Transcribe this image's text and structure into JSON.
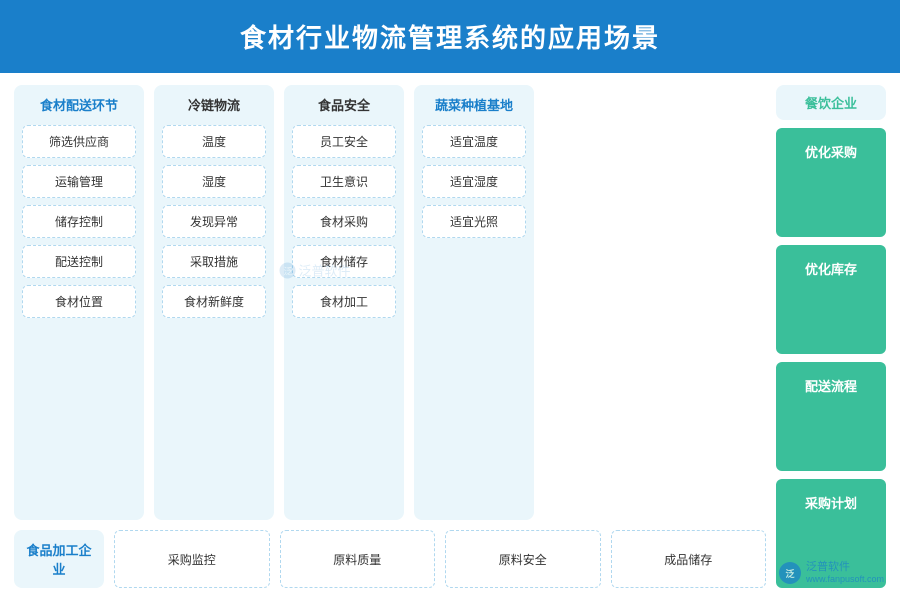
{
  "header": {
    "title": "食材行业物流管理系统的应用场景"
  },
  "columns": [
    {
      "id": "food-delivery",
      "title": "食材配送环节",
      "title_color": "blue",
      "items": [
        "筛选供应商",
        "运输管理",
        "储存控制",
        "配送控制",
        "食材位置"
      ]
    },
    {
      "id": "cold-chain",
      "title": "冷链物流",
      "title_color": "dark",
      "items": [
        "温度",
        "湿度",
        "发现异常",
        "采取措施",
        "食材新鲜度"
      ]
    },
    {
      "id": "food-safety",
      "title": "食品安全",
      "title_color": "dark",
      "items": [
        "员工安全",
        "卫生意识",
        "食材采购",
        "食材储存",
        "食材加工"
      ]
    },
    {
      "id": "veggie-base",
      "title": "蔬菜种植基地",
      "title_color": "blue",
      "items": [
        "适宜温度",
        "适宜湿度",
        "适宜光照"
      ]
    }
  ],
  "bottom_row": {
    "label": "食品加工企业",
    "items": [
      "采购监控",
      "原料质量",
      "原料安全",
      "成品储存"
    ]
  },
  "right_col": {
    "title": "餐饮企业",
    "buttons": [
      "优化采购",
      "优化库存",
      "配送流程",
      "采购计划"
    ]
  },
  "watermark": {
    "icon_text": "泛",
    "line1": "泛普软件",
    "line2": "www.fanpusoft.com"
  }
}
